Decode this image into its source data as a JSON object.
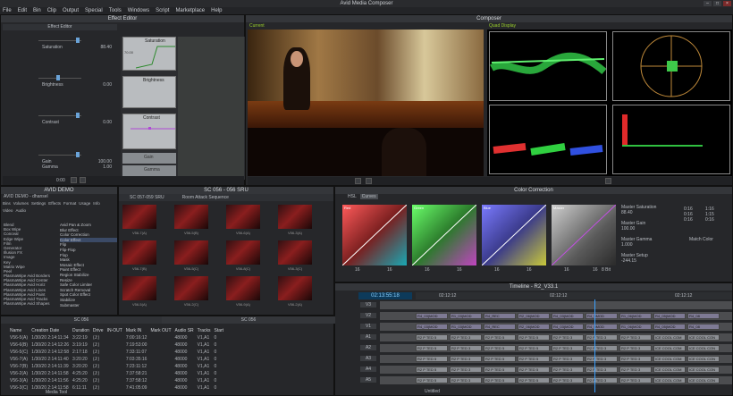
{
  "app_title": "Avid Media Composer",
  "menu": [
    "File",
    "Edit",
    "Bin",
    "Clip",
    "Output",
    "Special",
    "Tools",
    "Windows",
    "Script",
    "Marketplace",
    "Help"
  ],
  "effect_editor": {
    "title": "Effect Editor",
    "sub_title": "Effect Editor",
    "params": [
      {
        "name": "Saturation",
        "value": "88.40"
      },
      {
        "name": "Brightness",
        "value": "0.00"
      },
      {
        "name": "Contrast",
        "value": "0.00"
      },
      {
        "name": "Gain",
        "value": "100.00"
      },
      {
        "name": "Gamma",
        "value": "1.00"
      }
    ],
    "graphs": [
      "Saturation",
      "Brightness",
      "Contrast",
      "Gain",
      "Gamma"
    ],
    "graph_tick": "70.00",
    "timecode": "0:00"
  },
  "composer": {
    "title": "Composer",
    "left_label": "Current",
    "right_label": "Quad Display"
  },
  "bin_panel": {
    "title": "AVID DEMO",
    "sub": "AVID DEMO - dhansel",
    "tabs": [
      "Bins",
      "Volumes",
      "Settings",
      "Effects",
      "Format",
      "Usage",
      "Info"
    ],
    "subtabs": [
      "Video",
      "Audio"
    ],
    "effect_categories": [
      "Blend",
      "Box Wipe",
      "Conceal",
      "Edge Wipe",
      "Film",
      "Generator",
      "Illusion FX",
      "Image",
      "Key",
      "Matrix Wipe",
      "Peel",
      "PlasmaWipe Avid Borders",
      "PlasmaWipe Avid Center",
      "PlasmaWipe Avid Horiz",
      "PlasmaWipe Avid Lines",
      "PlasmaWipe Avid Paint",
      "PlasmaWipe Avid Tracks",
      "PlasmaWipe Avid Shapes"
    ],
    "effect_items": [
      "Avid Pan & Zoom",
      "Blur Effect",
      "Color Correction",
      "Color Effect",
      "Flip",
      "Flip-Flop",
      "Flop",
      "Mask",
      "Mosaic Effect",
      "Paint Effect",
      "Region Stabilize",
      "Resize",
      "Safe Color Limiter",
      "Scratch Removal",
      "Spot Color Effect",
      "Stabilize",
      "Submaster"
    ]
  },
  "seq_bin": {
    "title": "SC 056 - 056 SRU",
    "tab1": "SC 057-059 SRU",
    "tab2": "Room Attack Sequence",
    "thumb_labels": [
      "V56-7(A)",
      "V56-5(B)",
      "V56-6(A)",
      "V56-3(A)",
      "V56-7(B)",
      "V56-5(C)",
      "V56-8(C)",
      "V56-3(C)",
      "V56-5(A)",
      "V56-2(C)",
      "V56-9(A)",
      "V56-2(A)"
    ]
  },
  "color_correction": {
    "title": "Color Correction",
    "tabs": [
      "HSL",
      "Curves"
    ],
    "curves": [
      "Red",
      "Green",
      "Blue",
      "Master"
    ],
    "curve_in": "16",
    "curve_out": "16",
    "bit_label": "8 Bit",
    "master": [
      {
        "label": "Master Saturation",
        "value": "88.40"
      },
      {
        "label": "Master Gain",
        "value": "100.00"
      },
      {
        "label": "Master Gamma",
        "value": "1.000"
      },
      {
        "label": "Master Setup",
        "value": "-244.15"
      }
    ],
    "readouts": [
      "0:16",
      "1:16",
      "0:16",
      "1:15",
      "0:16",
      "0:16"
    ],
    "match_color": "Match Color"
  },
  "timeline": {
    "title": "Timeline - R2_V33.1",
    "timecode": "02:13:55:18",
    "ruler": [
      "02:12:12",
      "02:12:12",
      "02:12:12"
    ],
    "tracks": [
      "V3",
      "V2",
      "V1",
      "A1",
      "A2",
      "A3",
      "A4",
      "A5"
    ],
    "clip_v": [
      "R4_03(MOD",
      "R1_03(MOD",
      "R4_REC",
      "R2_06(MOD",
      "R4_03(MOD",
      "R4_5MOD",
      "R1_06(MOD",
      "R4_05(MOD",
      "R4_08"
    ],
    "clip_a": [
      "R2 P TED 5",
      "R2 P TED 3",
      "R2 P TED 5",
      "R2 P TED 5",
      "R2 P TED 3",
      "R2 P TED 3",
      "R2 P TED 3",
      "ICE COOL COM",
      "ICE COOL CON"
    ],
    "bottom_label": "Untitled"
  },
  "sc_bin": {
    "title1": "SC 056",
    "title2": "SC 056",
    "columns": [
      "Name",
      "Creation Date",
      "Duration",
      "Drive",
      "IN-OUT",
      "Mark IN",
      "Mark OUT",
      "Audio SR",
      "Tracks",
      "Start"
    ],
    "rows": [
      [
        "V56-5(A)",
        "1/30/20 2:14:11:34",
        "3:22:19",
        "(J:)",
        "",
        "7:00:16:12",
        "",
        "48000",
        "V1,A1",
        "0"
      ],
      [
        "V56-6(B)",
        "1/30/20 2:14:12:26",
        "3:19:19",
        "(J:)",
        "",
        "7:19:53:00",
        "",
        "48000",
        "V1,A1",
        "0"
      ],
      [
        "V56-5(C)",
        "1/30/20 2:14:12:58",
        "2:17:18",
        "(J:)",
        "",
        "7:33:11:07",
        "",
        "48000",
        "V1,A1",
        "0"
      ],
      [
        "V56-7(A)",
        "1/30/20 2:14:11:40",
        "3:20:20",
        "(J:)",
        "",
        "7:03:35:16",
        "",
        "48000",
        "V1,A1",
        "0"
      ],
      [
        "V56-7(B)",
        "1/30/20 2:14:11:39",
        "3:20:20",
        "(J:)",
        "",
        "7:23:11:12",
        "",
        "48000",
        "V1,A1",
        "0"
      ],
      [
        "V56-2(A)",
        "1/30/20 2:14:11:58",
        "4:25:20",
        "(J:)",
        "",
        "7:37:58:21",
        "",
        "48000",
        "V1,A1",
        "0"
      ],
      [
        "V56-3(A)",
        "1/30/20 2:14:11:56",
        "4:25:20",
        "(J:)",
        "",
        "7:37:58:12",
        "",
        "48000",
        "V1,A1",
        "0"
      ],
      [
        "V56-3(C)",
        "1/30/20 2:14:11:58",
        "6:11:11",
        "(J:)",
        "",
        "7:41:05:09",
        "",
        "48000",
        "V1,A1",
        "0"
      ]
    ],
    "footer": "Media Tool"
  }
}
